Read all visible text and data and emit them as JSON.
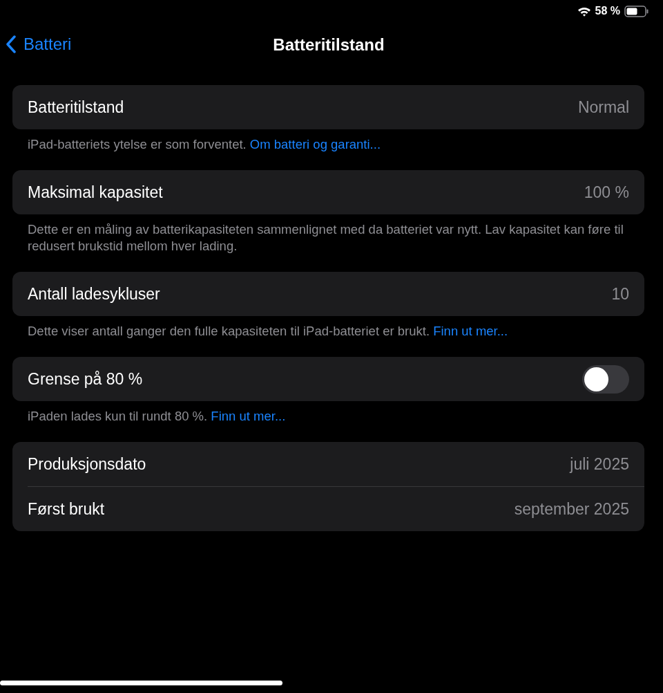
{
  "status_bar": {
    "battery_percent": "58 %"
  },
  "nav": {
    "back": "Batteri",
    "title": "Batteritilstand"
  },
  "sections": [
    {
      "rows": [
        {
          "kind": "value",
          "label": "Batteritilstand",
          "value": "Normal"
        }
      ],
      "footer": {
        "text": "iPad-batteriets ytelse er som forventet.",
        "link": "Om batteri og garanti..."
      }
    },
    {
      "rows": [
        {
          "kind": "value",
          "label": "Maksimal kapasitet",
          "value": "100 %"
        }
      ],
      "footer": {
        "text": "Dette er en måling av batterikapasiteten sammenlignet med da batteriet var nytt. Lav kapasitet kan føre til redusert brukstid mellom hver lading."
      }
    },
    {
      "rows": [
        {
          "kind": "value",
          "label": "Antall ladesykluser",
          "value": "10"
        }
      ],
      "footer": {
        "text": "Dette viser antall ganger den fulle kapasiteten til iPad-batteriet er brukt.",
        "link": "Finn ut mer..."
      }
    },
    {
      "rows": [
        {
          "kind": "toggle",
          "label": "Grense på 80 %",
          "on": false
        }
      ],
      "footer": {
        "text": "iPaden lades kun til rundt 80 %.",
        "link": "Finn ut mer..."
      }
    },
    {
      "rows": [
        {
          "kind": "value",
          "label": "Produksjonsdato",
          "value": "juli 2025"
        },
        {
          "kind": "value",
          "label": "Først brukt",
          "value": "september 2025"
        }
      ]
    }
  ]
}
